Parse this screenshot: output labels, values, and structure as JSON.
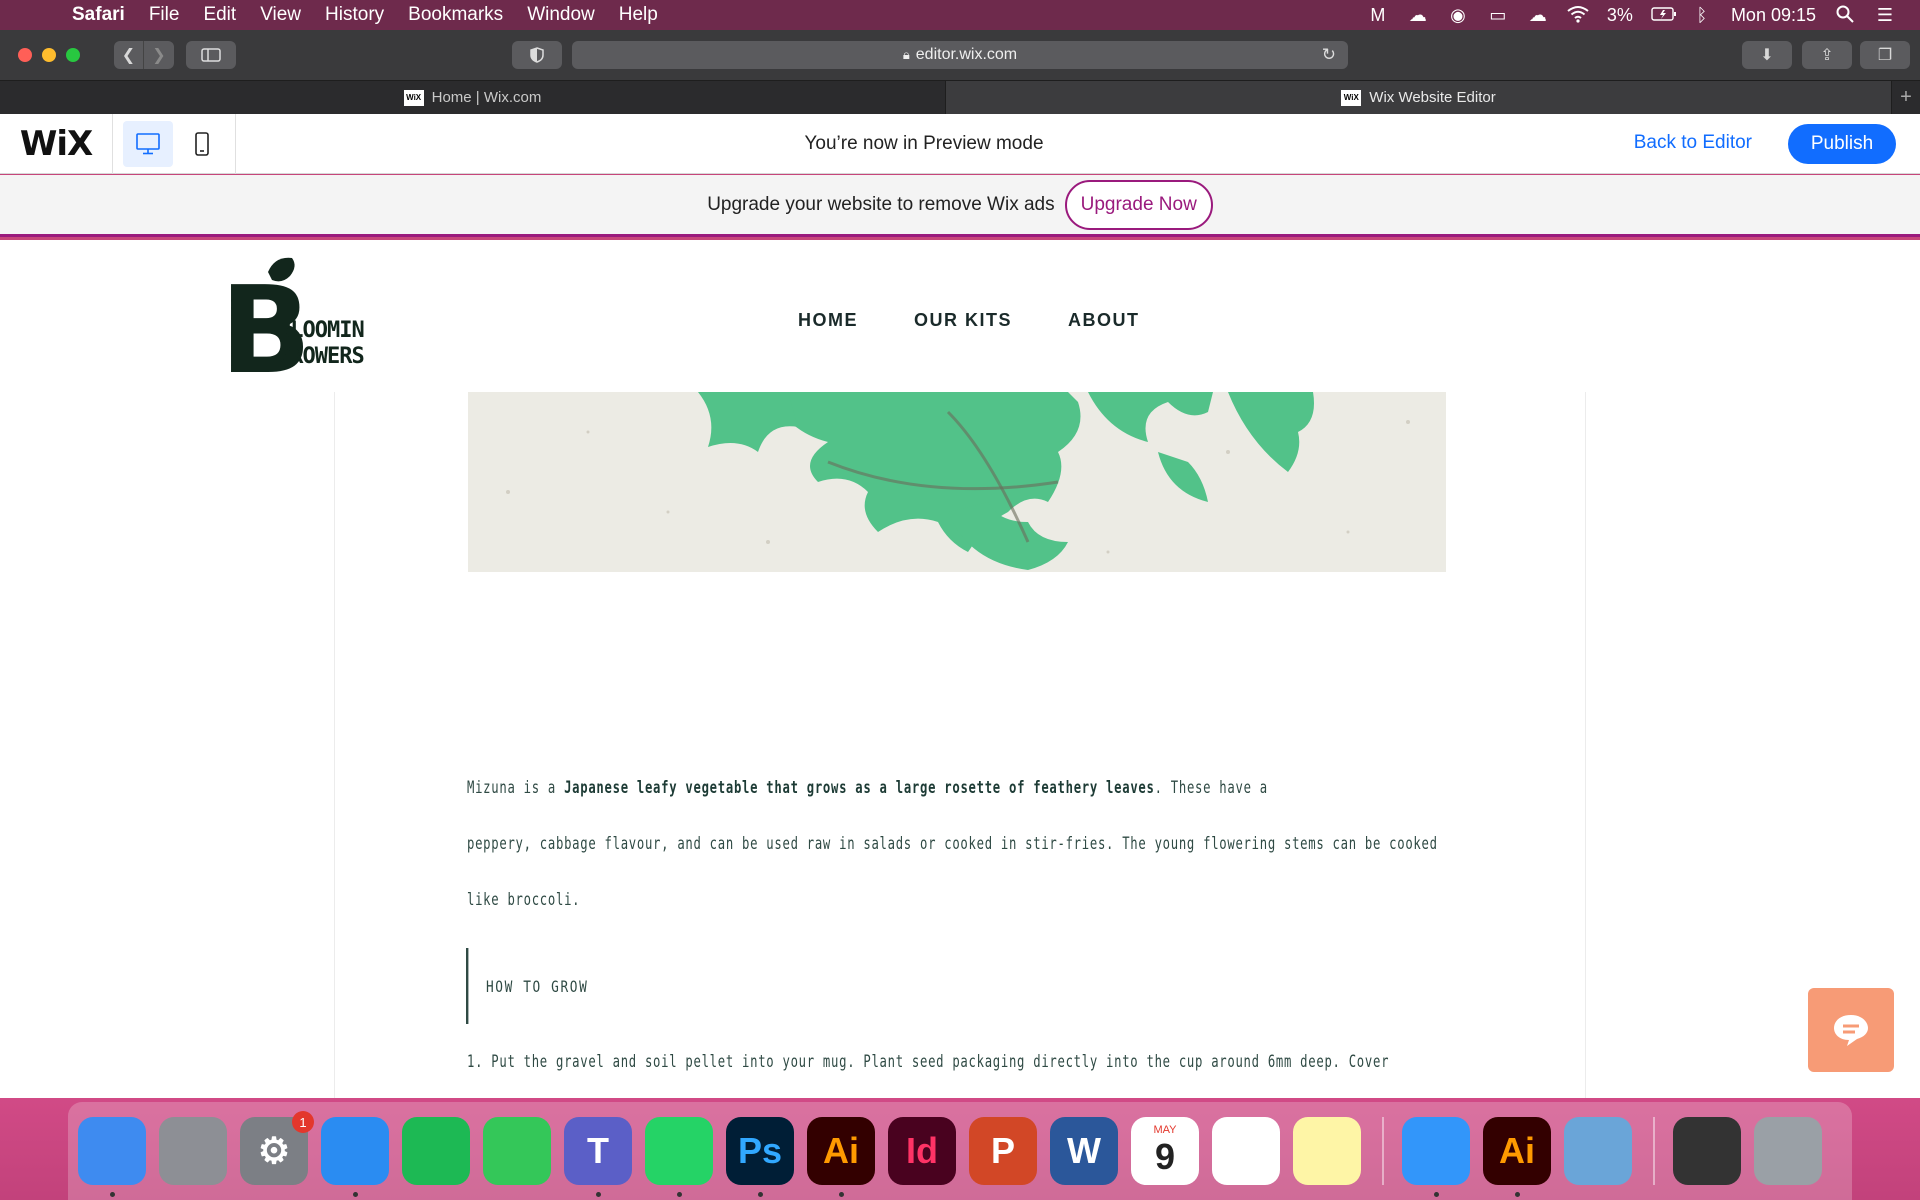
{
  "menubar": {
    "app_name": "Safari",
    "items": [
      "File",
      "Edit",
      "View",
      "History",
      "Bookmarks",
      "Window",
      "Help"
    ],
    "battery": "3%",
    "clock": "Mon 09:15"
  },
  "browser": {
    "url": "editor.wix.com",
    "tabs": [
      {
        "label": "Home | Wix.com",
        "favicon": "WiX"
      },
      {
        "label": "Wix Website Editor",
        "favicon": "WiX"
      }
    ]
  },
  "wix": {
    "logo": "WiX",
    "preview_message": "You’re now in Preview mode",
    "back_to_editor": "Back to Editor",
    "publish": "Publish",
    "upgrade_message": "Upgrade your website to remove Wix ads",
    "upgrade_button": "Upgrade Now"
  },
  "site": {
    "logo_line1": "BLOOMIN",
    "logo_line2": "GROWERS",
    "logo_letter": "B",
    "nav": [
      "HOME",
      "OUR KITS",
      "ABOUT"
    ],
    "para_line1_pre": " Mizuna is a ",
    "para_line1_bold": "Japanese leafy vegetable that grows as a large rosette of feathery leaves",
    "para_line1_post": ". These have a",
    "para_line2": "peppery, cabbage flavour, and can be used raw in salads or cooked in stir-fries. The young flowering stems can be cooked",
    "para_line3": "like broccoli.",
    "quote": "HOW TO GROW",
    "step1": "1. Put the gravel and soil pellet into your mug. Plant seed packaging directly into the cup around 6mm deep. Cover"
  },
  "dock": {
    "apps": [
      {
        "name": "Finder",
        "glyph": "",
        "bg": "#3e8bf0"
      },
      {
        "name": "Launchpad",
        "glyph": "",
        "bg": "#8d8f95"
      },
      {
        "name": "System Preferences",
        "glyph": "⚙",
        "bg": "#7c7f85",
        "badge": "1"
      },
      {
        "name": "Safari",
        "glyph": "",
        "bg": "#2a8cf2"
      },
      {
        "name": "Spotify",
        "glyph": "",
        "bg": "#1db954"
      },
      {
        "name": "FaceTime",
        "glyph": "",
        "bg": "#34c759"
      },
      {
        "name": "Teams",
        "glyph": "T",
        "bg": "#5b5fc7"
      },
      {
        "name": "WhatsApp",
        "glyph": "",
        "bg": "#25d366"
      },
      {
        "name": "Photoshop",
        "glyph": "Ps",
        "bg": "#001e36",
        "fg": "#31a8ff"
      },
      {
        "name": "Illustrator",
        "glyph": "Ai",
        "bg": "#330000",
        "fg": "#ff9a00"
      },
      {
        "name": "InDesign",
        "glyph": "Id",
        "bg": "#49021f",
        "fg": "#ff3366"
      },
      {
        "name": "PowerPoint",
        "glyph": "P",
        "bg": "#d24726"
      },
      {
        "name": "Word",
        "glyph": "W",
        "bg": "#2b579a"
      },
      {
        "name": "Calendar",
        "glyph": "9",
        "bg": "#ffffff",
        "fg": "#222",
        "month": "MAY"
      },
      {
        "name": "Reminders",
        "glyph": "",
        "bg": "#ffffff"
      },
      {
        "name": "Notes",
        "glyph": "",
        "bg": "#fef5a6"
      },
      {
        "name": "DingTalk",
        "glyph": "",
        "bg": "#3296fa"
      },
      {
        "name": "Illustrator 2",
        "glyph": "Ai",
        "bg": "#330000",
        "fg": "#ff9a00"
      },
      {
        "name": "Preview",
        "glyph": "",
        "bg": "#6aa5d8"
      },
      {
        "name": "Mission Control",
        "glyph": "",
        "bg": "#333"
      },
      {
        "name": "Trash",
        "glyph": "",
        "bg": "#9aa0a6"
      }
    ]
  }
}
